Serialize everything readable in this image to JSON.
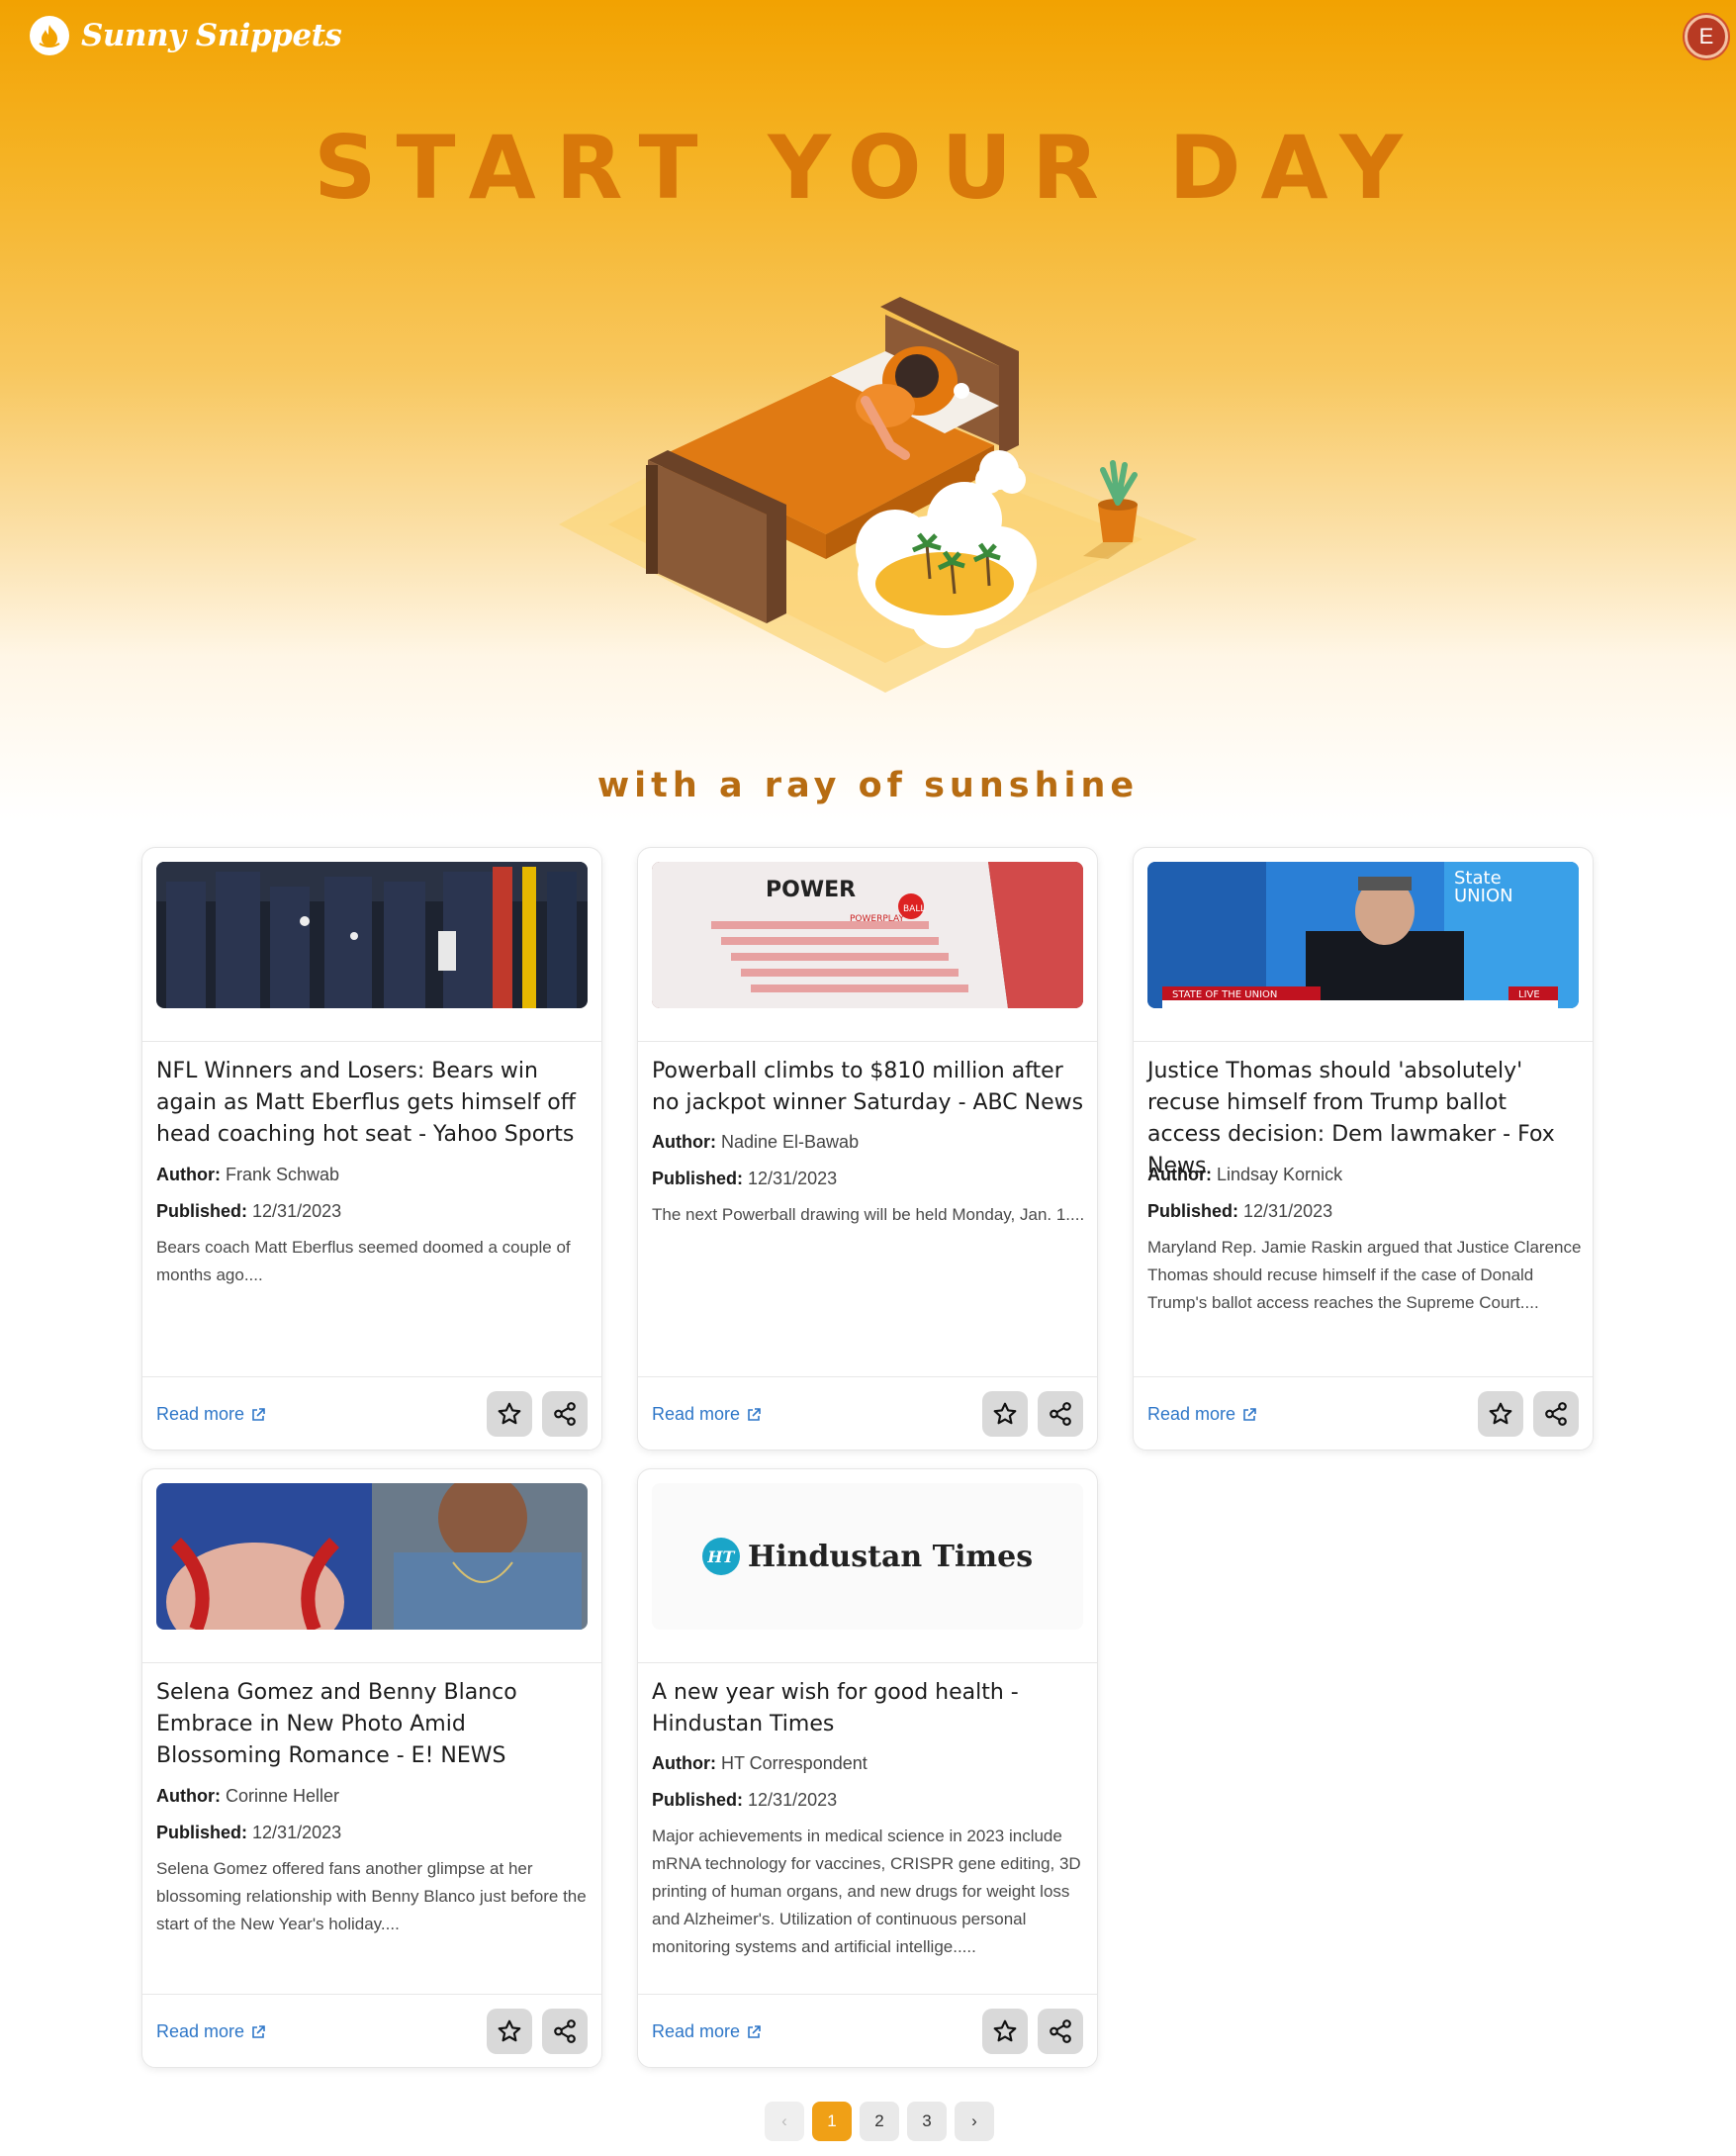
{
  "app": {
    "name": "Sunny Snippets",
    "user_initial": "E"
  },
  "hero": {
    "title": "START YOUR DAY",
    "tagline": "with a ray of sunshine"
  },
  "common": {
    "author_label": "Author:",
    "published_label": "Published:",
    "read_more": "Read more"
  },
  "cards": [
    {
      "title": "NFL Winners and Losers: Bears win again as Matt Eberflus gets himself off head coaching hot seat - Yahoo Sports",
      "author": "Frank Schwab",
      "published": "12/31/2023",
      "description": "Bears coach Matt Eberflus seemed doomed a couple of months ago...."
    },
    {
      "title": "Powerball climbs to $810 million after no jackpot winner Saturday - ABC News",
      "author": "Nadine El-Bawab",
      "published": "12/31/2023",
      "description": "The next Powerball drawing will be held Monday, Jan. 1....",
      "image_text": {
        "brand": "POWER",
        "brand_ball": "BALL",
        "sub": "POWERPLAY"
      }
    },
    {
      "title": "Justice Thomas should 'absolutely' recuse himself from Trump ballot access decision: Dem lawmaker - Fox News",
      "author": "Lindsay Kornick",
      "published": "12/31/2023",
      "description": "Maryland Rep. Jamie Raskin argued that Justice Clarence Thomas should recuse himself if the case of Donald Trump's ballot access reaches the Supreme Court....",
      "image_text": {
        "logo_line1": "State",
        "logo_line2": "UNION",
        "chyron": "STATE OF THE UNION",
        "live": "LIVE"
      }
    },
    {
      "title": "Selena Gomez and Benny Blanco Embrace in New Photo Amid Blossoming Romance - E! NEWS",
      "author": "Corinne Heller",
      "published": "12/31/2023",
      "description": "Selena Gomez offered fans another glimpse at her blossoming relationship with Benny Blanco just before the start of the New Year's holiday...."
    },
    {
      "title": "A new year wish for good health - Hindustan Times",
      "author": "HT Correspondent",
      "published": "12/31/2023",
      "description": "Major achievements in medical science in 2023 include mRNA technology for vaccines, CRISPR gene editing, 3D printing of human organs, and new drugs for weight loss and Alzheimer's. Utilization of continuous personal monitoring systems and artificial intellige.....",
      "image_text": {
        "badge": "HT",
        "wordmark": "Hindustan Times"
      }
    }
  ],
  "pagination": {
    "prev": "‹",
    "pages": [
      "1",
      "2",
      "3"
    ],
    "current": "1",
    "next": "›"
  },
  "colors": {
    "brand_orange": "#f2a201",
    "title_orange": "#d8780a",
    "link_blue": "#2f77c8"
  },
  "icons": [
    "logo-flame-icon",
    "star-icon",
    "share-icon",
    "external-link-icon"
  ]
}
